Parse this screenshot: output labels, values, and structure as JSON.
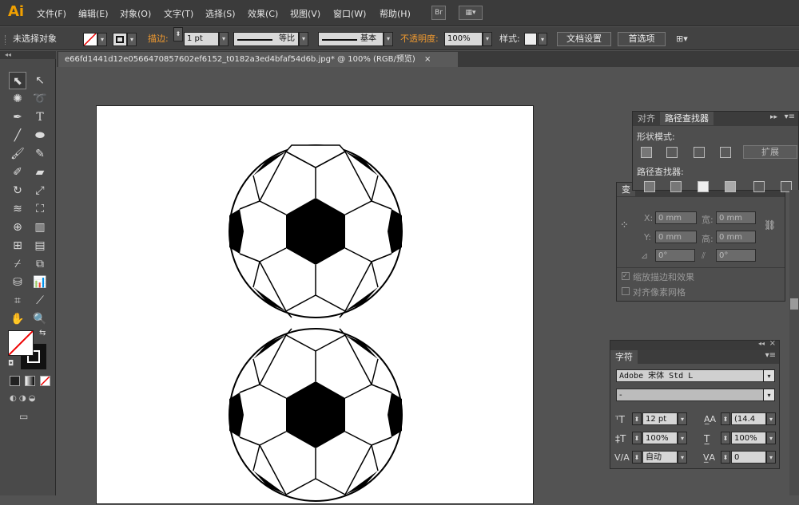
{
  "app": {
    "logo": "Ai"
  },
  "menu": [
    "文件(F)",
    "编辑(E)",
    "对象(O)",
    "文字(T)",
    "选择(S)",
    "效果(C)",
    "视图(V)",
    "窗口(W)",
    "帮助(H)"
  ],
  "menubar_buttons": {
    "bridge": "Br"
  },
  "control_bar": {
    "selection_status": "未选择对象",
    "stroke_label": "描边:",
    "stroke_weight": "1 pt",
    "profile_label": "等比",
    "brush_label": "基本",
    "opacity_label": "不透明度:",
    "opacity_value": "100%",
    "style_label": "样式:",
    "doc_setup_button": "文档设置",
    "preferences_button": "首选项"
  },
  "document": {
    "tab_title": "e66fd1441d12e0566470857602ef6152_t0182a3ed4bfaf54d6b.jpg* @ 100% (RGB/预览)",
    "close_glyph": "×"
  },
  "pathfinder_panel": {
    "tabs": [
      "对齐",
      "路径查找器"
    ],
    "shape_modes_label": "形状模式:",
    "expand_button": "扩展",
    "pathfinders_label": "路径查找器:"
  },
  "transform_panel": {
    "tab_partial": "变",
    "x_label": "X:",
    "x_value": "0 mm",
    "y_label": "Y:",
    "y_value": "0 mm",
    "w_label": "宽:",
    "w_value": "0 mm",
    "h_label": "高:",
    "h_value": "0 mm",
    "rotate_value": "0°",
    "shear_value": "0°",
    "scale_strokes": "缩放描边和效果",
    "align_pixel": "对齐像素网格"
  },
  "character_panel": {
    "tab": "字符",
    "font_family": "Adobe 宋体 Std L",
    "font_style": "-",
    "font_size": "12 pt",
    "leading": "(14.4",
    "vertical_scale": "100%",
    "horizontal_scale": "100%",
    "kerning": "自动",
    "tracking": "0"
  },
  "colors": {
    "accent": "#f09a30",
    "background": "#535353",
    "ball_black": "#000000"
  }
}
